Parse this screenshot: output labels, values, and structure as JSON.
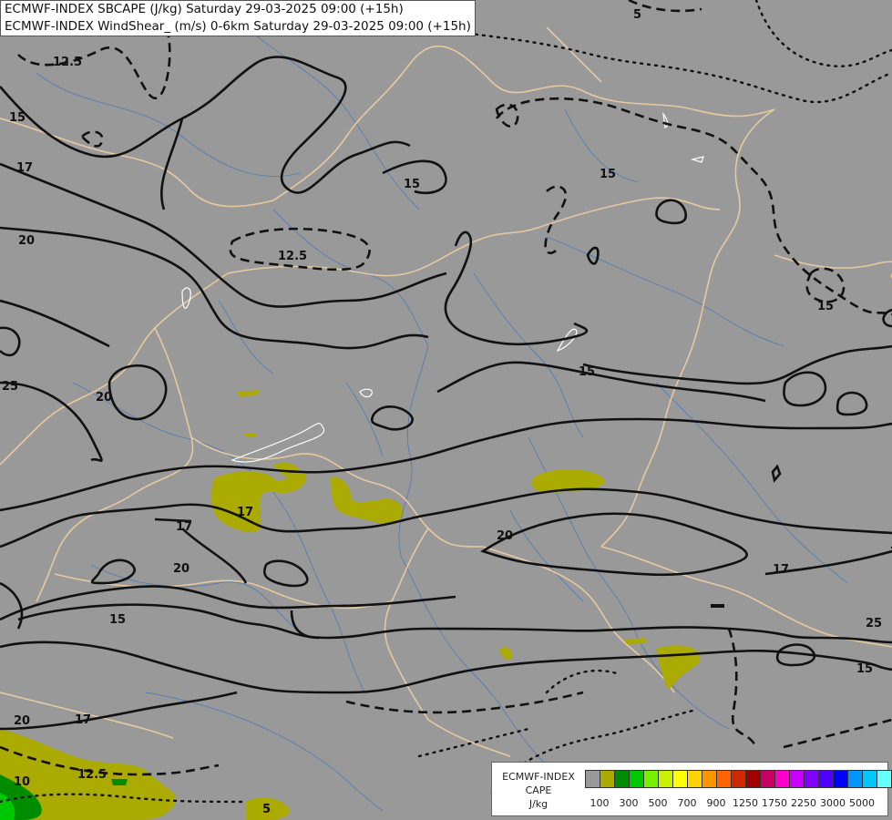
{
  "titles": {
    "line1": "ECMWF-INDEX SBCAPE (J/kg) Saturday 29-03-2025 09:00 (+15h)",
    "line2": "ECMWF-INDEX WindShear_ (m/s) 0-6km Saturday 29-03-2025 09:00 (+15h)"
  },
  "legend": {
    "title_line1": "ECMWF-INDEX",
    "title_line2": "CAPE",
    "unit": "J/kg",
    "colors": [
      "#999999",
      "#aaaa00",
      "#008c00",
      "#00c800",
      "#78f000",
      "#c8f000",
      "#ffff00",
      "#ffd200",
      "#ff9600",
      "#ff6400",
      "#d22800",
      "#a00000",
      "#c80064",
      "#ff00c8",
      "#c800ff",
      "#8200ff",
      "#5000ff",
      "#0000ff",
      "#0096ff",
      "#00c8ff",
      "#64ffff",
      "#ffffff"
    ],
    "tick_labels": [
      "100",
      "300",
      "500",
      "700",
      "900",
      "1250",
      "1750",
      "2250",
      "3000",
      "5000"
    ]
  },
  "contour_labels": {
    "label_12_5_a": "12.5",
    "label_12_5_b": "12.5",
    "label_12_5_c": "12.5",
    "label_15_a": "15",
    "label_15_b": "15",
    "label_15_c": "15",
    "label_15_d": "15",
    "label_15_e": "15",
    "label_15_f": "15",
    "label_15_g": "15",
    "label_17_a": "17",
    "label_17_b": "17",
    "label_17_c": "17",
    "label_17_d": "17",
    "label_17_e": "17",
    "label_20_a": "20",
    "label_20_b": "20",
    "label_20_c": "20",
    "label_20_d": "20",
    "label_20_e": "20",
    "label_25_a": "25",
    "label_25_b": "25",
    "label_10_a": "10",
    "label_10_b": "10",
    "label_5_a": "5",
    "label_5_b": "5"
  }
}
